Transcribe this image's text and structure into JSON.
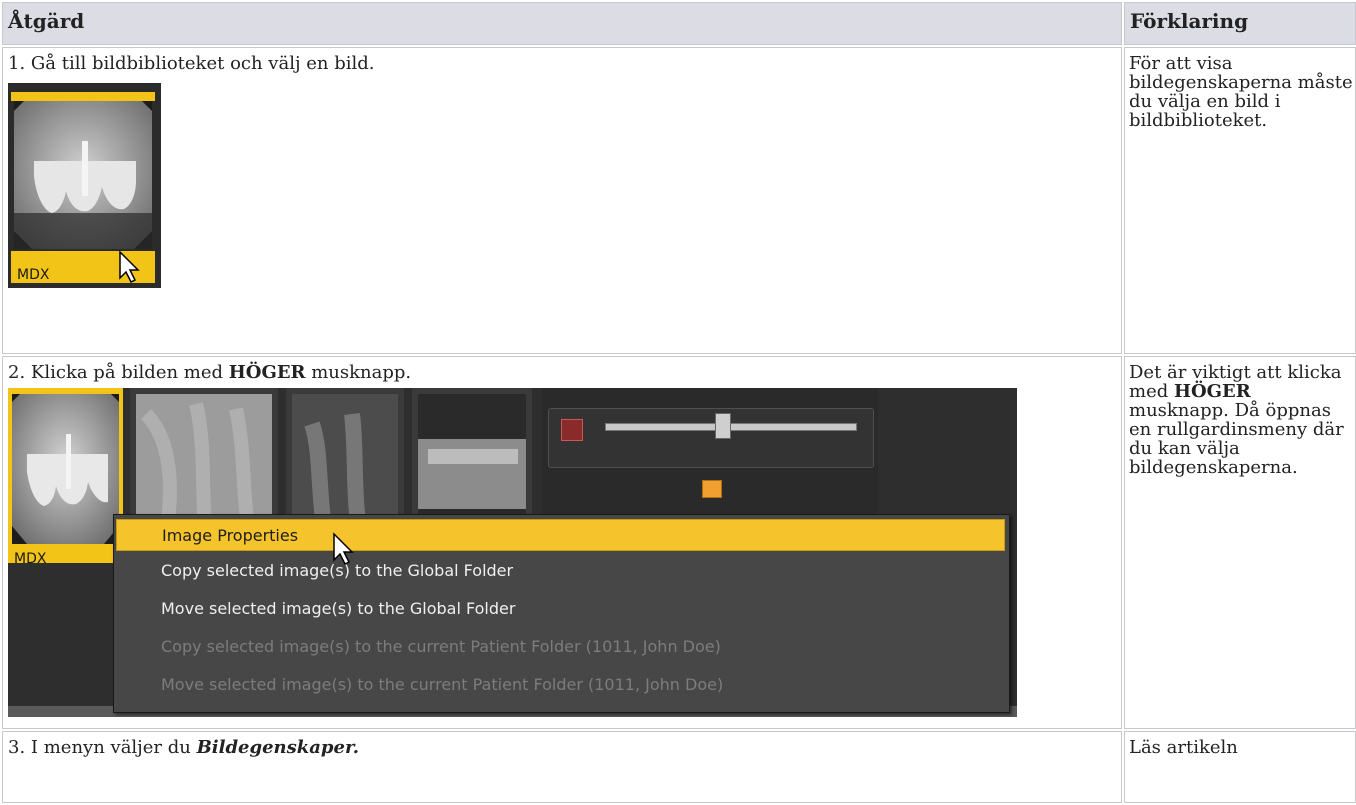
{
  "table": {
    "header_action": "Åtgärd",
    "header_explanation": "Förklaring"
  },
  "step1": {
    "text": "1. Gå till bildbiblioteket och välj en bild.",
    "thumbnail_label": "MDX",
    "note": "För att visa bildegenskaperna måste du välja en bild i bildbiblioteket."
  },
  "step2": {
    "text_pre": "2. Klicka på bilden med ",
    "text_bold": "HÖGER",
    "text_post": " musknapp.",
    "thumbnail_label": "MDX",
    "menu_items": [
      {
        "label": "Image Properties",
        "state": "active"
      },
      {
        "label": "Copy selected image(s) to the Global Folder",
        "state": "enabled"
      },
      {
        "label": "Move selected image(s) to the Global Folder",
        "state": "enabled"
      },
      {
        "label": "Copy selected image(s) to the current Patient Folder (1011, John Doe)",
        "state": "disabled"
      },
      {
        "label": "Move selected image(s) to the current Patient Folder (1011, John Doe)",
        "state": "disabled"
      }
    ],
    "note_pre": "Det är viktigt att klicka med ",
    "note_bold": "HÖGER",
    "note_post": " musknapp. Då öppnas en rullgardinsmeny där du kan välja bildegenskaperna."
  },
  "step3": {
    "text_pre": "3. I menyn väljer du ",
    "text_bold_italic": "Bildegenskaper.",
    "note": "Läs artikeln"
  },
  "colors": {
    "highlight": "#f2c418",
    "menu_bg": "#474747",
    "header_bg": "#dcdce4"
  }
}
